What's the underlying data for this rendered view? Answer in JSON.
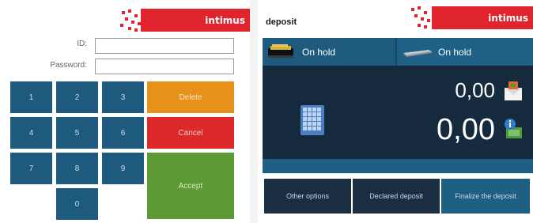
{
  "brand": "intimus",
  "login": {
    "id_label": "ID:",
    "password_label": "Password:",
    "id_value": "",
    "password_value": "",
    "keys": [
      "1",
      "2",
      "3",
      "4",
      "5",
      "6",
      "7",
      "8",
      "9",
      "0"
    ],
    "delete_label": "Delete",
    "cancel_label": "Cancel",
    "accept_label": "Accept"
  },
  "deposit": {
    "title": "deposit",
    "tabs": [
      {
        "label": "On hold",
        "icon": "bill-tray-icon"
      },
      {
        "label": "On hold",
        "icon": "coin-tray-icon"
      }
    ],
    "amount_top": "0,00",
    "amount_bottom": "0,00",
    "buttons": {
      "other": "Other options",
      "declared": "Declared deposit",
      "finalize": "Finalize the deposit"
    }
  },
  "colors": {
    "brand_red": "#e0242d",
    "key_blue": "#1d5a7e",
    "delete_orange": "#e6921a",
    "cancel_red": "#dc2a2c",
    "accept_green": "#5d9a34",
    "deposit_dark": "#152a3d"
  }
}
